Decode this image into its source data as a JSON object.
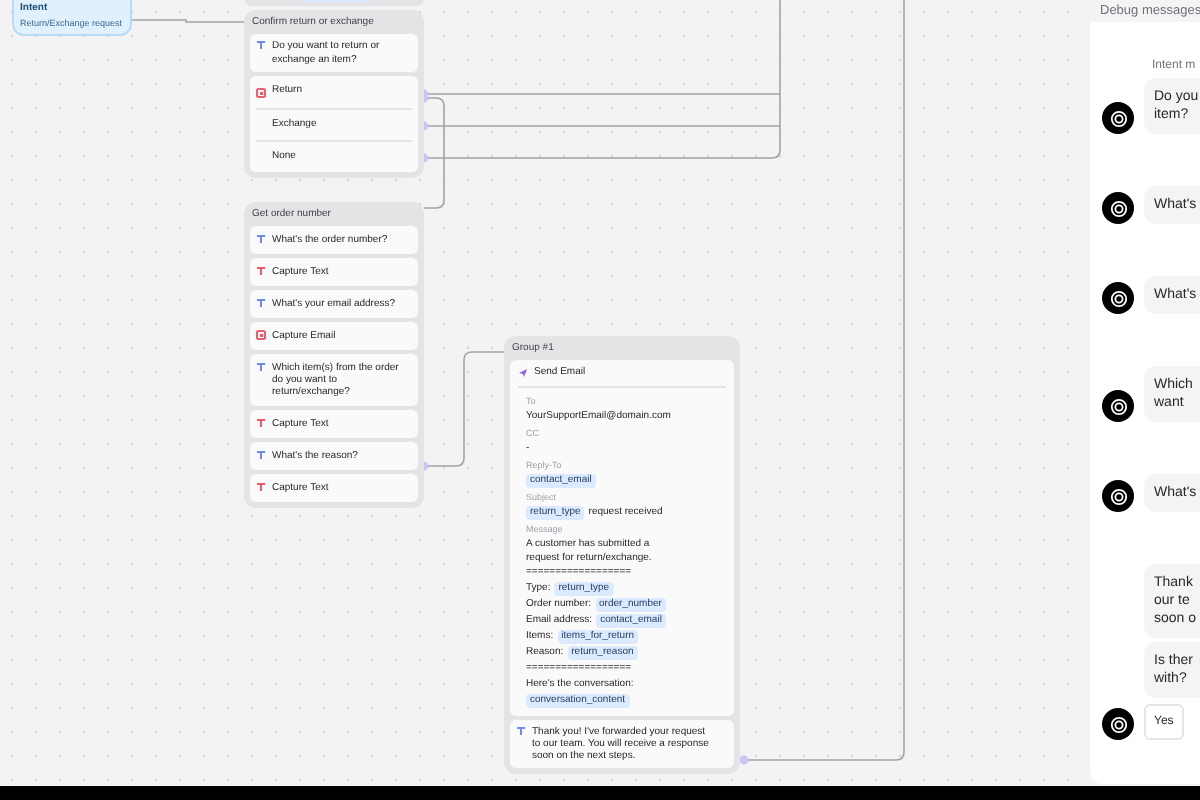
{
  "intent_node": {
    "title": "Intent",
    "subtitle": "Return/Exchange request"
  },
  "confirm_node": {
    "title": "Confirm return or exchange",
    "question": "Do you want to return or exchange an item?",
    "options": [
      {
        "label": "Return",
        "marked": true
      },
      {
        "label": "Exchange",
        "marked": false
      },
      {
        "label": "None",
        "marked": false
      }
    ]
  },
  "order_node": {
    "title": "Get order number",
    "steps": [
      {
        "kind": "message",
        "text": "What's the order number?"
      },
      {
        "kind": "capture_text",
        "text": "Capture Text"
      },
      {
        "kind": "message",
        "text": "What's your email address?"
      },
      {
        "kind": "capture_email",
        "text": "Capture Email"
      },
      {
        "kind": "message",
        "text": "Which item(s) from the order do you want to return/exchange?"
      },
      {
        "kind": "capture_text",
        "text": "Capture Text"
      },
      {
        "kind": "message",
        "text": "What's the reason?"
      },
      {
        "kind": "capture_text",
        "text": "Capture Text"
      }
    ]
  },
  "group_node": {
    "title": "Group #1",
    "email": {
      "title": "Send Email",
      "fields": [
        {
          "label": "To",
          "parts": [
            {
              "kind": "text",
              "text": "YourSupportEmail@domain.com"
            }
          ]
        },
        {
          "label": "CC",
          "parts": [
            {
              "kind": "text",
              "text": "-"
            }
          ]
        },
        {
          "label": "Reply-To",
          "parts": [
            {
              "kind": "var",
              "text": "contact_email"
            }
          ]
        },
        {
          "label": "Subject",
          "parts": [
            {
              "kind": "var",
              "text": "return_type"
            },
            {
              "kind": "text",
              "text": "request received"
            }
          ]
        }
      ],
      "message_label": "Message",
      "message_lines": [
        [
          {
            "kind": "text",
            "text": "A customer has submitted a request for return/exchange."
          }
        ],
        [
          {
            "kind": "text",
            "text": "=================="
          }
        ],
        [
          {
            "kind": "text",
            "text": "Type:"
          },
          {
            "kind": "var",
            "text": "return_type"
          }
        ],
        [
          {
            "kind": "text",
            "text": "Order number:"
          },
          {
            "kind": "var",
            "text": "order_number"
          }
        ],
        [
          {
            "kind": "text",
            "text": "Email address:"
          },
          {
            "kind": "var",
            "text": "contact_email"
          }
        ],
        [
          {
            "kind": "text",
            "text": "Items:"
          },
          {
            "kind": "var",
            "text": "items_for_return"
          }
        ],
        [
          {
            "kind": "text",
            "text": "Reason:"
          },
          {
            "kind": "var",
            "text": "return_reason"
          }
        ],
        [
          {
            "kind": "text",
            "text": "=================="
          }
        ],
        [
          {
            "kind": "text",
            "text": "Here's the conversation:"
          }
        ],
        [
          {
            "kind": "var",
            "text": "conversation_content"
          }
        ]
      ]
    },
    "reply": "Thank you! I've forwarded your request to our team. You will receive a response soon on the next steps."
  },
  "debug_panel": {
    "title": "Debug messages",
    "caption": "Intent m",
    "groups": [
      {
        "messages": [
          "Do you\nitem?"
        ]
      },
      {
        "messages": [
          "What's"
        ]
      },
      {
        "messages": [
          "What's"
        ]
      },
      {
        "messages": [
          "Which\nwant"
        ]
      },
      {
        "messages": [
          "What's"
        ]
      },
      {
        "messages": [
          "Thank\nour te\nsoon o",
          "Is ther\nwith?"
        ],
        "quick_replies": [
          "Yes"
        ]
      }
    ]
  }
}
